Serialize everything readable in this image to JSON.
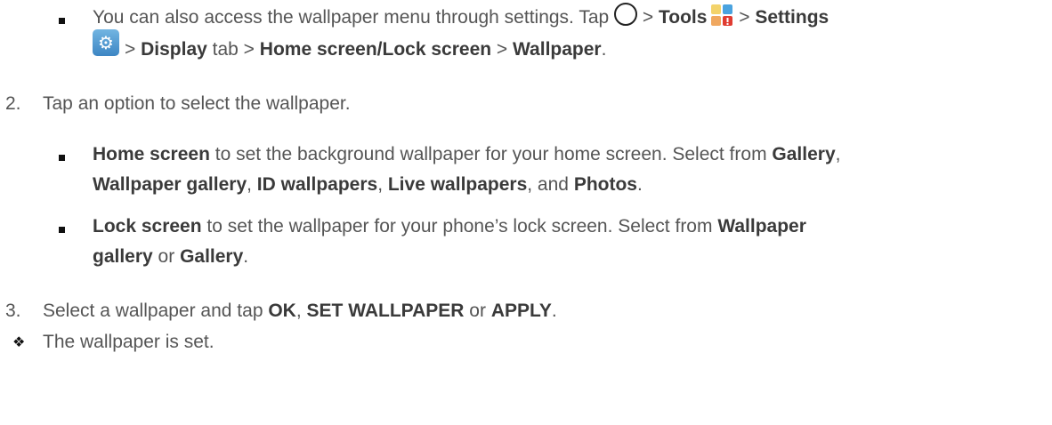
{
  "tip": {
    "t1": "You can also access the wallpaper menu through settings. Tap ",
    "sep1": " > ",
    "tools": "Tools",
    "sep2": " > ",
    "settings": "Settings",
    "sep3": " > ",
    "display": "Display",
    "t_tab": " tab > ",
    "home_lock": "Home screen/Lock screen",
    "sep4": " > ",
    "wallpaper": "Wallpaper",
    "end": "."
  },
  "step2": {
    "num": "2.",
    "text": "Tap an option to select the wallpaper."
  },
  "home": {
    "label": "Home screen",
    "t1": " to set the background wallpaper for your home screen. Select from ",
    "gallery": "Gallery",
    "comma1": ",",
    "wallpaper_gallery": "Wallpaper gallery",
    "comma2": ", ",
    "id_wallpapers": "ID wallpapers",
    "comma3": ", ",
    "live_wallpapers": "Live wallpapers",
    "and": ", and ",
    "photos": "Photos",
    "end": "."
  },
  "lock": {
    "label": "Lock screen",
    "t1": " to set the wallpaper for your phone’s lock screen. Select from ",
    "wallpaper": "Wallpaper",
    "gallery_word": "gallery",
    "or": " or ",
    "gallery": "Gallery",
    "end": "."
  },
  "step3": {
    "num": "3.",
    "t1": "Select a wallpaper and tap ",
    "ok": "OK",
    "comma": ", ",
    "set_wallpaper": "SET WALLPAPER",
    "or": " or ",
    "apply": "APPLY",
    "end": "."
  },
  "result": {
    "text": "The wallpaper is set."
  },
  "icons": {
    "home": "home-circle-icon",
    "tools": "tools-folder-icon",
    "settings": "settings-gear-icon",
    "bullet": "square-bullet",
    "result": "four-diamond-bullet"
  }
}
